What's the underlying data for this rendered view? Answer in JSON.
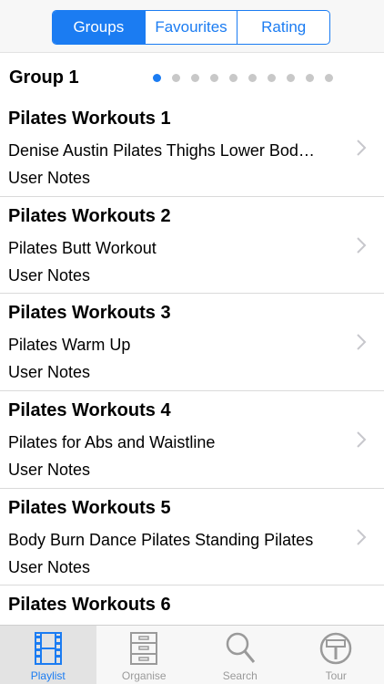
{
  "segments": [
    {
      "label": "Groups",
      "active": true
    },
    {
      "label": "Favourites",
      "active": false
    },
    {
      "label": "Rating",
      "active": false
    }
  ],
  "group": {
    "title": "Group 1",
    "pages": {
      "total": 10,
      "current": 1
    }
  },
  "items": [
    {
      "title": "Pilates Workouts 1",
      "subtitle": "Denise Austin Pilates Thighs  Lower Body Workout",
      "notes": "User Notes"
    },
    {
      "title": "Pilates Workouts 2",
      "subtitle": "Pilates Butt Workout",
      "notes": "User Notes"
    },
    {
      "title": "Pilates Workouts 3",
      "subtitle": "Pilates Warm Up",
      "notes": "User Notes"
    },
    {
      "title": "Pilates Workouts 4",
      "subtitle": "Pilates for Abs and Waistline",
      "notes": "User Notes"
    },
    {
      "title": "Pilates Workouts 5",
      "subtitle": "Body Burn Dance  Pilates Standing Pilates",
      "notes": "User Notes"
    },
    {
      "title": "Pilates Workouts 6",
      "subtitle": "",
      "notes": ""
    }
  ],
  "tabs": [
    {
      "label": "Playlist",
      "icon": "film-icon",
      "active": true
    },
    {
      "label": "Organise",
      "icon": "cabinet-icon",
      "active": false
    },
    {
      "label": "Search",
      "icon": "search-icon",
      "active": false
    },
    {
      "label": "Tour",
      "icon": "signpost-icon",
      "active": false
    }
  ],
  "colors": {
    "accent": "#1b7cf2",
    "inactive": "#9a9a9a"
  }
}
